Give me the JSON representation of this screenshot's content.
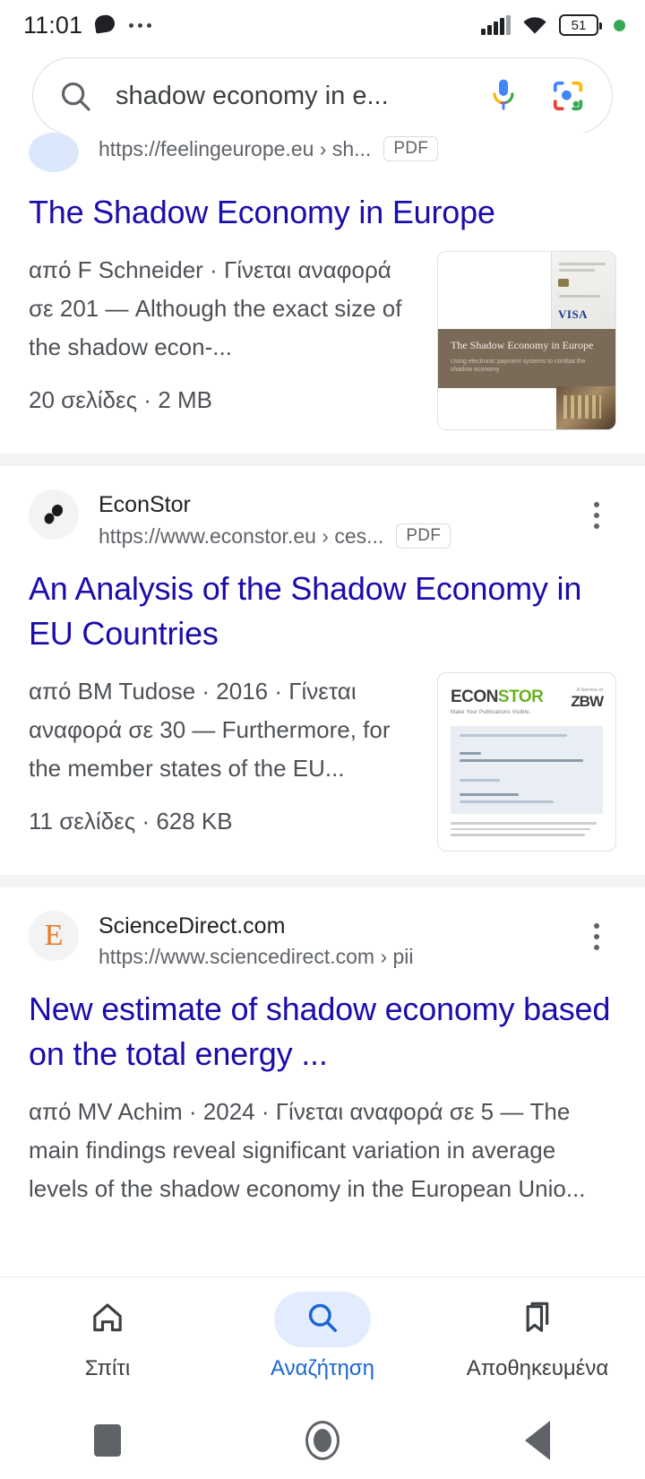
{
  "status_bar": {
    "time": "11:01",
    "battery_level": "51",
    "icons": [
      "chat-bubble-icon",
      "more-dots-icon",
      "signal-icon",
      "wifi-icon",
      "battery-icon",
      "recording-dot-icon"
    ]
  },
  "search": {
    "query": "shadow economy in e...",
    "search_icon": "search-icon",
    "mic_icon": "microphone-icon",
    "lens_icon": "google-lens-icon"
  },
  "results": [
    {
      "source_name": "",
      "url": "https://feelingeurope.eu › sh...",
      "badge": "PDF",
      "title": "The Shadow Economy in Europe",
      "snippet": "από F Schneider · Γίνεται αναφορά σε 201 — Although the exact size of the shadow econ-...",
      "meta": "20 σελίδες · 2 MB",
      "thumbnail": {
        "type": "pdf-cover",
        "band_title": "The Shadow Economy in Europe",
        "band_subtitle": "Using electronic payment systems to combat the shadow economy",
        "card_label": "VISA"
      }
    },
    {
      "source_name": "EconStor",
      "url": "https://www.econstor.eu › ces...",
      "badge": "PDF",
      "title": "An Analysis of the Shadow Economy in EU Countries",
      "snippet": "από BM Tudose · 2016 · Γίνεται αναφορά σε 30 — Furthermore, for the member states of the EU...",
      "meta": "11 σελίδες · 628 KB",
      "thumbnail": {
        "type": "pdf-cover",
        "logo_dark": "ECON",
        "logo_green": "STOR",
        "logo_sub": "Make Your Publications Visible.",
        "partner_small": "A Service of",
        "partner_big": "ZBW"
      }
    },
    {
      "source_name": "ScienceDirect.com",
      "url": "https://www.sciencedirect.com › pii",
      "badge": "",
      "title": "New estimate of shadow economy based on the total energy ...",
      "snippet": "από MV Achim · 2024 · Γίνεται αναφορά σε 5 — The main findings reveal significant variation in average levels of the shadow economy in the European Unio...",
      "meta": "",
      "favicon_letter": "E"
    }
  ],
  "bottom_nav": {
    "items": [
      {
        "label": "Σπίτι",
        "icon": "home-icon",
        "active": false
      },
      {
        "label": "Αναζήτηση",
        "icon": "search-icon",
        "active": true
      },
      {
        "label": "Αποθηκευμένα",
        "icon": "bookmark-icon",
        "active": false
      }
    ]
  },
  "system_nav": {
    "recent_apps": "square-icon",
    "home": "circle-icon",
    "back": "triangle-back-icon"
  },
  "colors": {
    "link": "#1a0dab",
    "accent": "#1967d2",
    "pill": "#e3ecfd",
    "text": "#202124",
    "muted": "#5f6368",
    "snippet": "#4d5156"
  }
}
